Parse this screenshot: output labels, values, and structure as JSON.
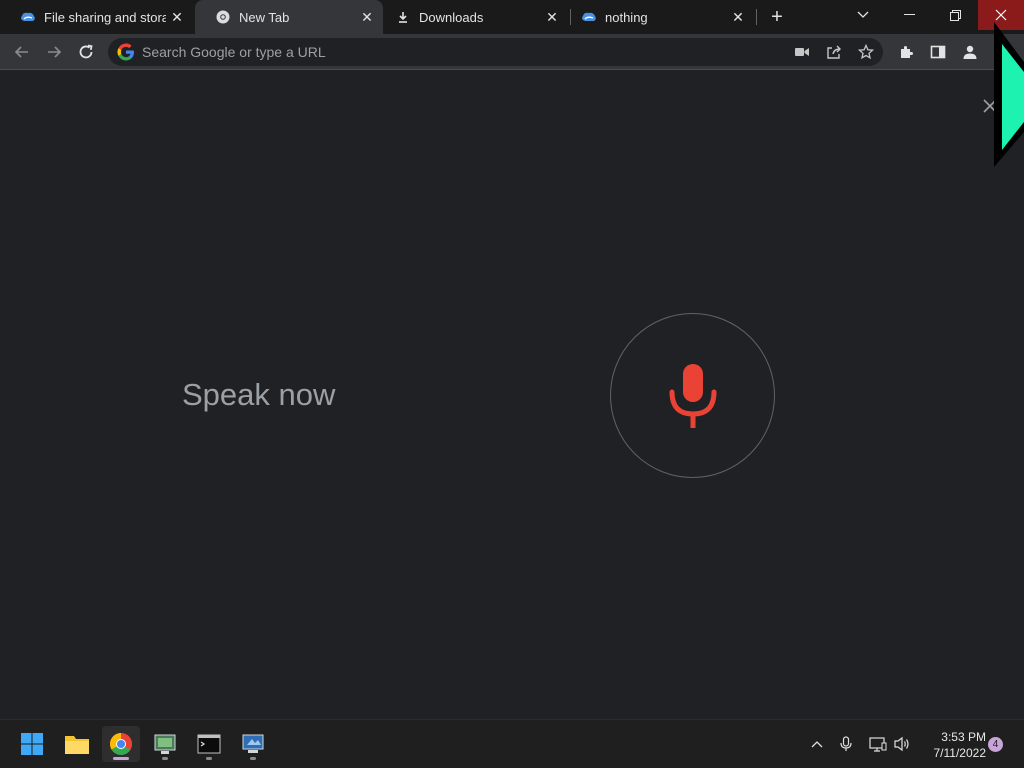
{
  "tabs": [
    {
      "title": "File sharing and storag",
      "icon": "cloud-icon",
      "active": false
    },
    {
      "title": "New Tab",
      "icon": "chrome-icon",
      "active": true
    },
    {
      "title": "Downloads",
      "icon": "download-icon",
      "active": false
    },
    {
      "title": "nothing",
      "icon": "cloud-icon",
      "active": false
    }
  ],
  "omnibox": {
    "placeholder": "Search Google or type a URL"
  },
  "voice_search": {
    "prompt": "Speak now",
    "mic_color": "#ea4335"
  },
  "taskbar": {
    "apps": [
      "start-icon",
      "file-explorer-icon",
      "chrome-icon",
      "app-icon",
      "terminal-icon",
      "remote-desktop-icon"
    ],
    "clock_time": "3:53 PM",
    "clock_date": "7/11/2022",
    "notifications": "4"
  },
  "colors": {
    "accent_cursor": "#1ef2b0",
    "close_hover": "#8b1a1a",
    "background": "#202124"
  }
}
